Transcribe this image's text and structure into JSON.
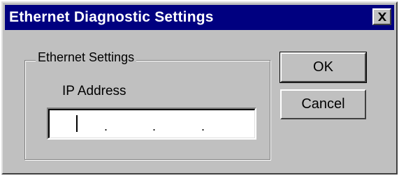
{
  "window": {
    "title": "Ethernet Diagnostic Settings",
    "close_icon": "close-x-icon"
  },
  "group": {
    "label": "Ethernet Settings"
  },
  "ip": {
    "label": "IP Address",
    "octets": [
      "",
      "",
      "",
      ""
    ],
    "separators": [
      ".",
      ".",
      "."
    ]
  },
  "buttons": {
    "ok_label": "OK",
    "cancel_label": "Cancel"
  },
  "colors": {
    "title_bar": "#000080",
    "face": "#c0c0c0",
    "title_text": "#ffffff"
  }
}
